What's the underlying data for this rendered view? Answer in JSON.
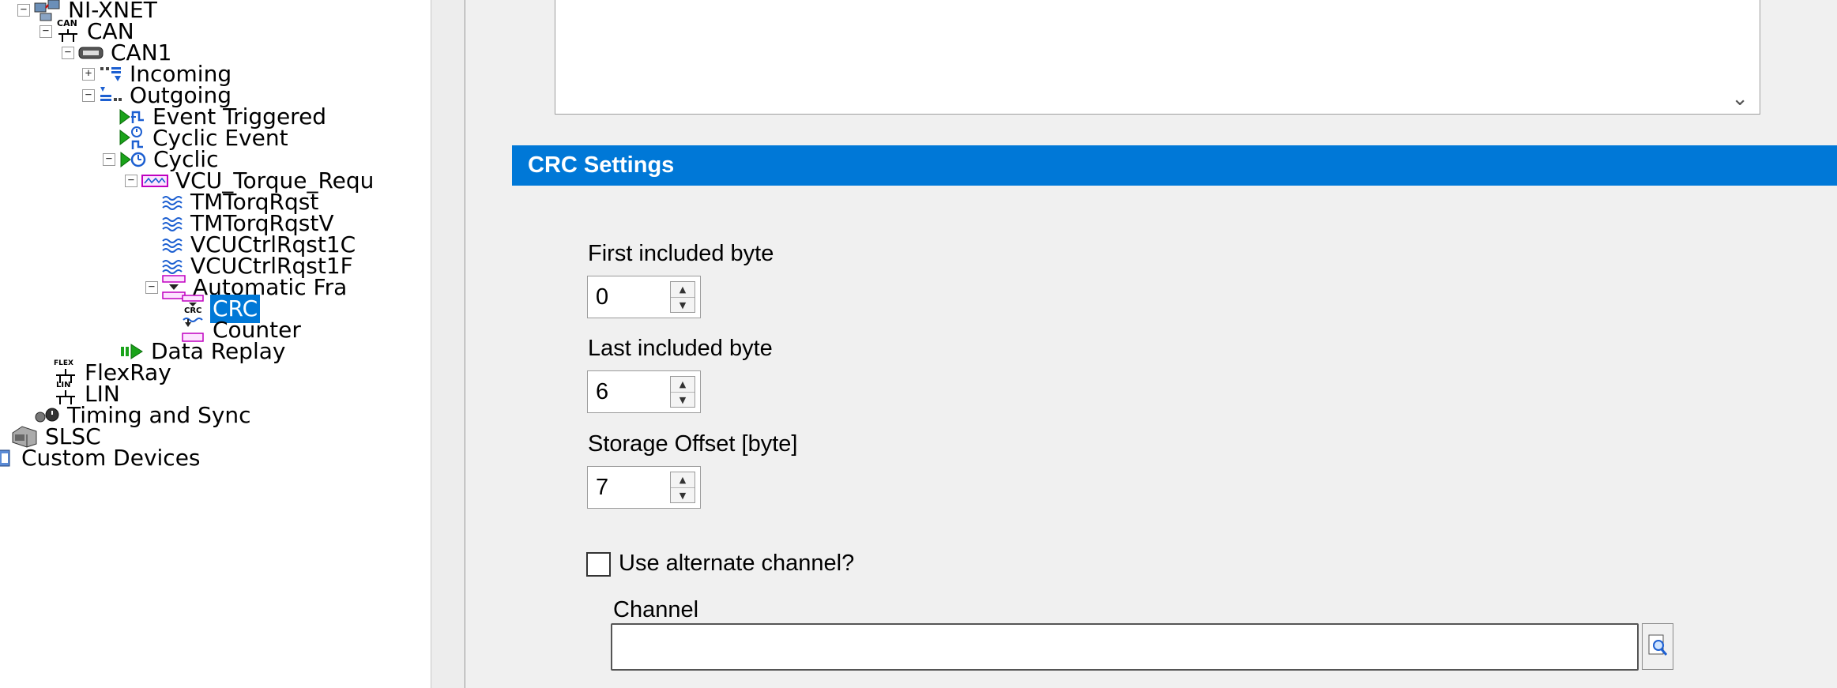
{
  "tree": {
    "ni_xnet": "NI-XNET",
    "can": "CAN",
    "can1": "CAN1",
    "incoming": "Incoming",
    "outgoing": "Outgoing",
    "event_triggered": "Event Triggered",
    "cyclic_event": "Cyclic Event",
    "cyclic": "Cyclic",
    "vcu_frame": "VCU_Torque_Requ",
    "signals": [
      "TMTorqRqst",
      "TMTorqRqstV",
      "VCUCtrlRqst1C",
      "VCUCtrlRqst1F"
    ],
    "automatic_frame": "Automatic Fra",
    "crc": "CRC",
    "counter": "Counter",
    "data_replay": "Data Replay",
    "flexray": "FlexRay",
    "lin": "LIN",
    "timing_sync": "Timing and Sync",
    "slsc": "SLSC",
    "custom_devices": "Custom Devices",
    "icon_texts": {
      "can": "CAN",
      "flex": "FLEX",
      "lin": "LIN",
      "crc": "CRC"
    }
  },
  "section": {
    "title": "CRC Settings"
  },
  "fields": {
    "first_included_byte": {
      "label": "First included byte",
      "value": "0"
    },
    "last_included_byte": {
      "label": "Last included byte",
      "value": "6"
    },
    "storage_offset": {
      "label": "Storage Offset [byte]",
      "value": "7"
    }
  },
  "alternate_channel": {
    "label": "Use alternate channel?",
    "checked": false
  },
  "channel": {
    "label": "Channel",
    "value": ""
  },
  "colors": {
    "selection": "#0078d7",
    "header": "#0078d7",
    "pane_bg": "#f0f0f0"
  }
}
